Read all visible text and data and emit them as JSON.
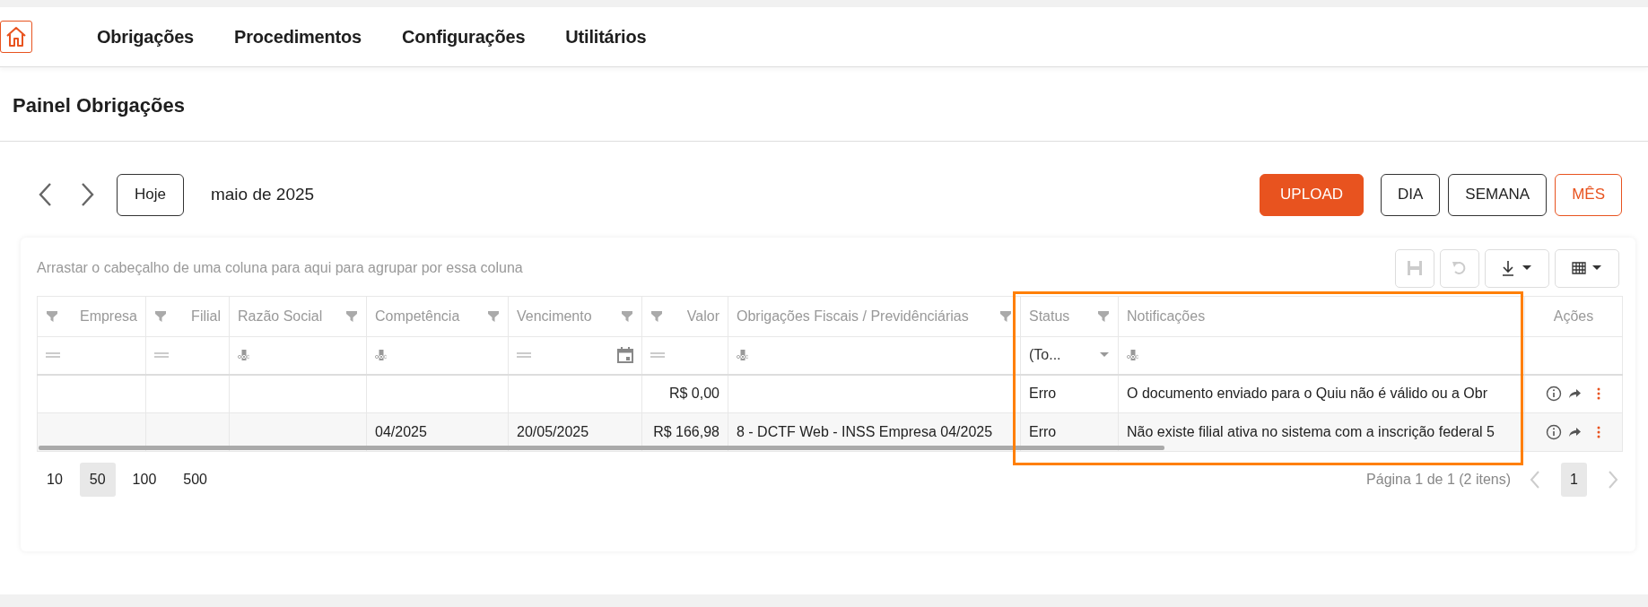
{
  "nav": {
    "items": [
      {
        "label": "Obrigações"
      },
      {
        "label": "Procedimentos"
      },
      {
        "label": "Configurações"
      },
      {
        "label": "Utilitários"
      }
    ]
  },
  "page_title": "Painel Obrigações",
  "calendar_toolbar": {
    "today_button": "Hoje",
    "period": "maio de 2025",
    "upload_button": "UPLOAD",
    "views": [
      {
        "label": "DIA",
        "selected": false
      },
      {
        "label": "SEMANA",
        "selected": false
      },
      {
        "label": "MÊS",
        "selected": true
      }
    ]
  },
  "grid": {
    "group_panel_hint": "Arrastar o cabeçalho de uma coluna para aqui para agrupar por essa coluna",
    "columns": [
      {
        "label": "Empresa",
        "right_aligned": true,
        "centered": false,
        "filter": true
      },
      {
        "label": "Filial",
        "right_aligned": true,
        "centered": false,
        "filter": true
      },
      {
        "label": "Razão Social",
        "right_aligned": false,
        "centered": false,
        "filter": true
      },
      {
        "label": "Competência",
        "right_aligned": false,
        "centered": false,
        "filter": true
      },
      {
        "label": "Vencimento",
        "right_aligned": false,
        "centered": false,
        "filter": true
      },
      {
        "label": "Valor",
        "right_aligned": true,
        "centered": false,
        "filter": true
      },
      {
        "label": "Obrigações Fiscais / Previdênciárias",
        "right_aligned": false,
        "centered": false,
        "filter": true
      },
      {
        "label": "Status",
        "right_aligned": false,
        "centered": false,
        "filter": true
      },
      {
        "label": "Notificações",
        "right_aligned": false,
        "centered": false,
        "filter": false
      },
      {
        "label": "Ações",
        "right_aligned": false,
        "centered": true,
        "filter": false
      }
    ],
    "filter_row": [
      {
        "kind": "equals"
      },
      {
        "kind": "equals"
      },
      {
        "kind": "text"
      },
      {
        "kind": "text"
      },
      {
        "kind": "date"
      },
      {
        "kind": "equals"
      },
      {
        "kind": "text"
      },
      {
        "kind": "select",
        "value": "(To..."
      },
      {
        "kind": "text"
      },
      {
        "kind": "empty"
      }
    ],
    "rows": [
      {
        "cells": [
          null,
          null,
          null,
          null,
          null,
          "R$ 0,00",
          null,
          "Erro",
          "O documento enviado para o Quiu não é válido ou a Obr"
        ]
      },
      {
        "cells": [
          null,
          null,
          null,
          "04/2025",
          "20/05/2025",
          "R$ 166,98",
          "8 - DCTF Web - INSS Empresa 04/2025",
          "Erro",
          "Não existe filial ativa no sistema com a inscrição federal 5"
        ]
      }
    ],
    "page_sizes": [
      {
        "label": "10",
        "selected": false
      },
      {
        "label": "50",
        "selected": true
      },
      {
        "label": "100",
        "selected": false
      },
      {
        "label": "500",
        "selected": false
      }
    ],
    "page_info": "Página 1 de 1 (2 itens)",
    "pages": [
      {
        "label": "1",
        "selected": true
      }
    ]
  }
}
